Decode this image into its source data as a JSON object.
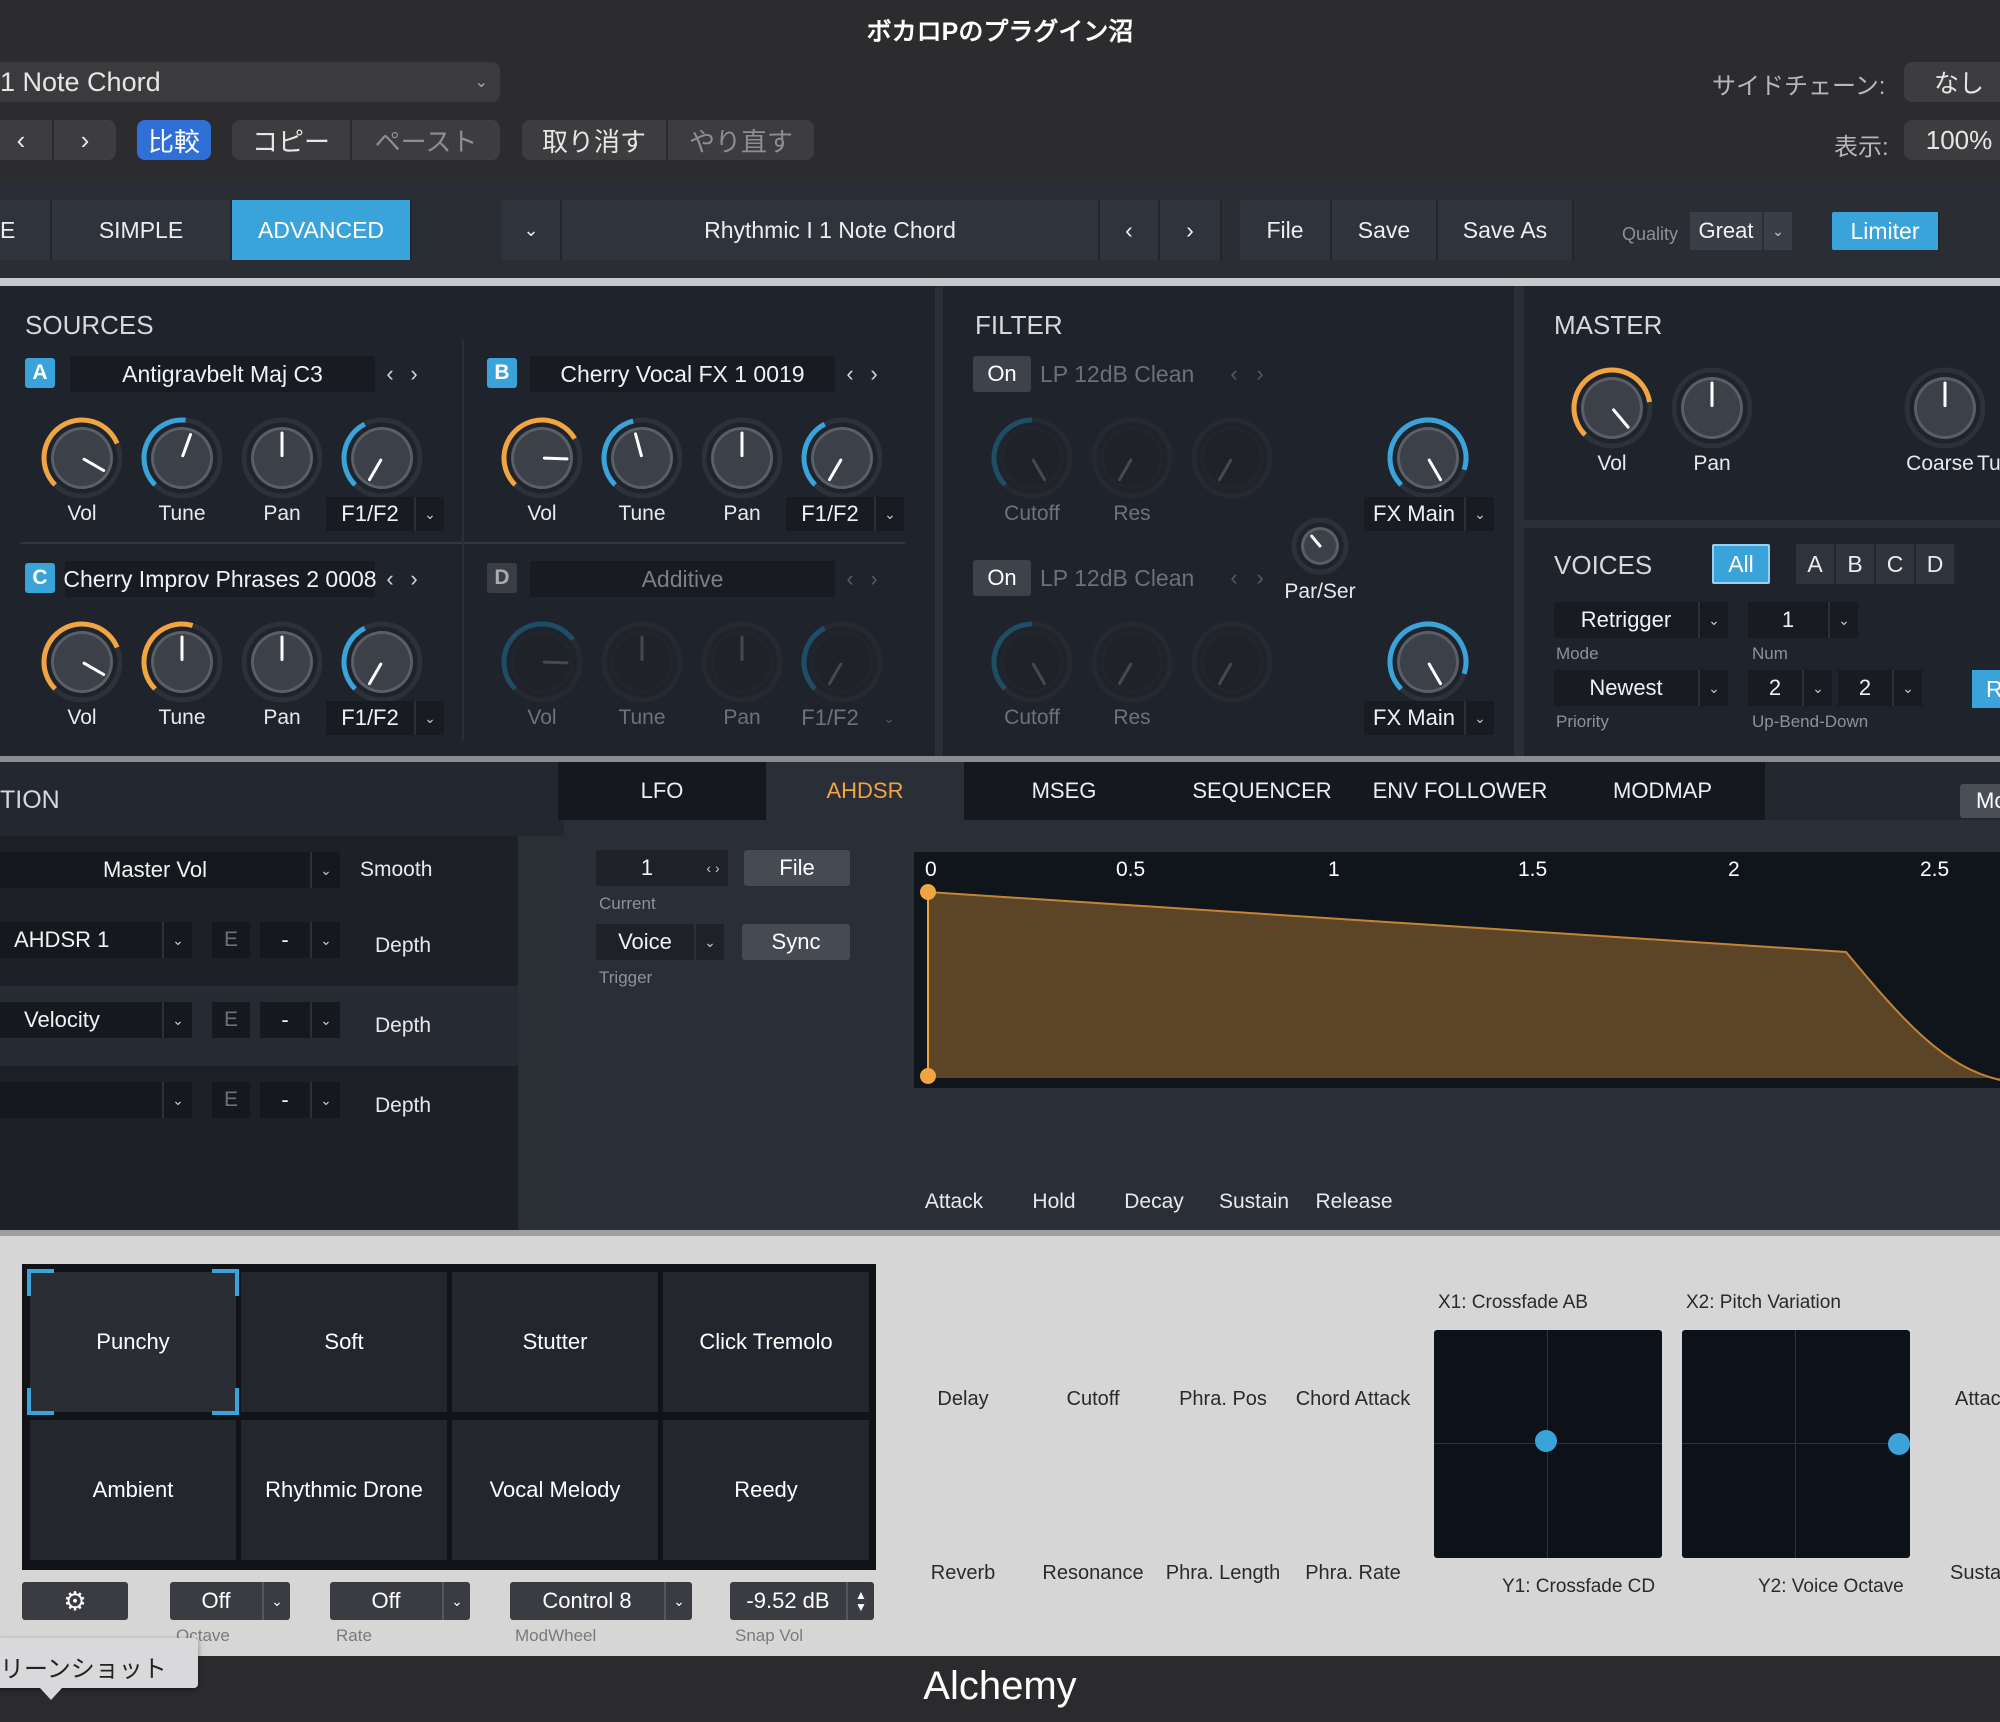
{
  "window": {
    "title": "ボカロPのプラグイン沼",
    "footer_title": "Alchemy"
  },
  "header": {
    "preset_menu": "1 Note Chord",
    "sidechain_label": "サイドチェーン:",
    "sidechain_value": "なし",
    "view_label": "表示:",
    "view_value": "100%",
    "compare": "比較",
    "copy": "コピー",
    "paste": "ペースト",
    "undo": "取り消す",
    "redo": "やり直す"
  },
  "toolbar": {
    "mode_partial": "E",
    "simple": "SIMPLE",
    "advanced": "ADVANCED",
    "preset_name": "Rhythmic I 1 Note Chord",
    "file": "File",
    "save": "Save",
    "save_as": "Save As",
    "quality_label": "Quality",
    "quality_value": "Great",
    "limiter": "Limiter"
  },
  "sources": {
    "title": "SOURCES",
    "a": {
      "letter": "A",
      "name": "Antigravbelt Maj C3"
    },
    "b": {
      "letter": "B",
      "name": "Cherry Vocal FX 1 0019"
    },
    "c": {
      "letter": "C",
      "name": "Cherry Improv Phrases 2 0008"
    },
    "d": {
      "letter": "D",
      "name": "Additive"
    },
    "labels": {
      "vol": "Vol",
      "tune": "Tune",
      "pan": "Pan",
      "f1f2": "F1/F2"
    }
  },
  "filter": {
    "title": "FILTER",
    "on": "On",
    "type1": "LP 12dB Clean",
    "type2": "LP 12dB Clean",
    "cutoff": "Cutoff",
    "res": "Res",
    "fxmain": "FX Main",
    "parser": "Par/Ser"
  },
  "master": {
    "title": "MASTER",
    "vol": "Vol",
    "pan": "Pan",
    "coarse": "Coarse",
    "tune_partial": "Tu"
  },
  "voices": {
    "title": "VOICES",
    "all": "All",
    "letters": [
      "A",
      "B",
      "C",
      "D"
    ],
    "mode_value": "Retrigger",
    "mode_label": "Mode",
    "num_value": "1",
    "num_label": "Num",
    "priority_value": "Newest",
    "priority_label": "Priority",
    "bend_up": "2",
    "bend_down": "2",
    "bend_label": "Up-Bend-Down",
    "partial_btn": "R"
  },
  "modulation": {
    "title_partial": "TION",
    "target": "Master Vol",
    "smooth": "Smooth",
    "rows": [
      {
        "source": "AHDSR 1",
        "e": "E",
        "sel": "-",
        "depth": "Depth"
      },
      {
        "source": "Velocity",
        "e": "E",
        "sel": "-",
        "depth": "Depth"
      },
      {
        "source": "",
        "e": "E",
        "sel": "-",
        "depth": "Depth"
      }
    ],
    "tabs": [
      "LFO",
      "AHDSR",
      "MSEG",
      "SEQUENCER",
      "ENV FOLLOWER",
      "MODMAP"
    ],
    "active_tab": "AHDSR",
    "mo_partial": "Mo",
    "current_value": "1",
    "current_label": "Current",
    "file": "File",
    "trigger_value": "Voice",
    "trigger_label": "Trigger",
    "sync": "Sync",
    "timeline": [
      "0",
      "0.5",
      "1",
      "1.5",
      "2",
      "2.5"
    ],
    "env_knobs": [
      "Attack",
      "Hold",
      "Decay",
      "Sustain",
      "Release"
    ]
  },
  "performance": {
    "pads": [
      "Punchy",
      "Soft",
      "Stutter",
      "Click Tremolo",
      "Ambient",
      "Rhythmic Drone",
      "Vocal Melody",
      "Reedy"
    ],
    "selected_pad": "Punchy",
    "knobs_top": [
      "Delay",
      "Cutoff",
      "Phra. Pos",
      "Chord Attack"
    ],
    "knobs_bottom": [
      "Reverb",
      "Resonance",
      "Phra. Length",
      "Phra. Rate"
    ],
    "x1": "X1: Crossfade AB",
    "y1": "Y1: Crossfade CD",
    "x2": "X2: Pitch Variation",
    "y2": "Y2: Voice Octave",
    "right_partial_top": "Attac",
    "right_partial_bottom": "Susta",
    "octave_value": "Off",
    "octave_label": "Octave",
    "rate_value": "Off",
    "rate_label": "Rate",
    "modwheel_value": "Control 8",
    "modwheel_label": "ModWheel",
    "snapvol_value": "-9.52 dB",
    "snapvol_label": "Snap Vol"
  },
  "tooltip": {
    "text": "リーンショット"
  },
  "colors": {
    "accent_blue": "#3aa3d9",
    "accent_orange": "#f0a442",
    "panel": "#1f232b",
    "light_panel": "#d8d8d8"
  }
}
